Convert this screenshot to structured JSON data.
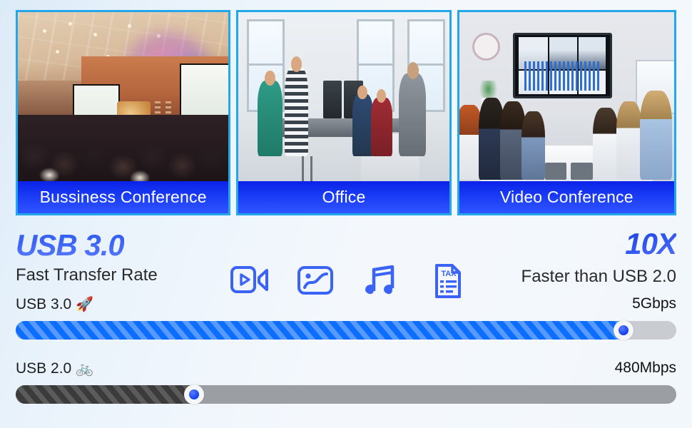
{
  "photos": [
    {
      "caption": "Bussiness Conference",
      "scene": "business-conference-hall"
    },
    {
      "caption": "Office",
      "scene": "open-plan-office"
    },
    {
      "caption": "Video Conference",
      "scene": "video-conference-room"
    }
  ],
  "headline": {
    "left_title": "USB 3.0",
    "left_subtitle": "Fast Transfer Rate",
    "right_title": "10X",
    "right_subtitle": "Faster than USB 2.0"
  },
  "feature_icons": [
    {
      "name": "video-icon",
      "label": "Video"
    },
    {
      "name": "photo-icon",
      "label": "Photo"
    },
    {
      "name": "music-icon",
      "label": "Music"
    },
    {
      "name": "tax-document-icon",
      "label": "TAX"
    }
  ],
  "speed_bars": [
    {
      "label": "USB 3.0",
      "emoji": "🚀",
      "emoji_name": "rocket-emoji",
      "speed": "5Gbps",
      "fill_percent": 92,
      "fill_color": "#0d6efd",
      "track_color": "#c9ccd0"
    },
    {
      "label": "USB 2.0",
      "emoji": "🚲",
      "emoji_name": "bicycle-emoji",
      "speed": "480Mbps",
      "fill_percent": 27,
      "fill_color": "#3b3b3b",
      "track_color": "#9b9ea2"
    }
  ],
  "colors": {
    "accent_blue": "#0d6efd",
    "photo_border_cyan": "#22a8ea",
    "caption_blue": "#1a3cf5",
    "background": "#eef4fb"
  }
}
